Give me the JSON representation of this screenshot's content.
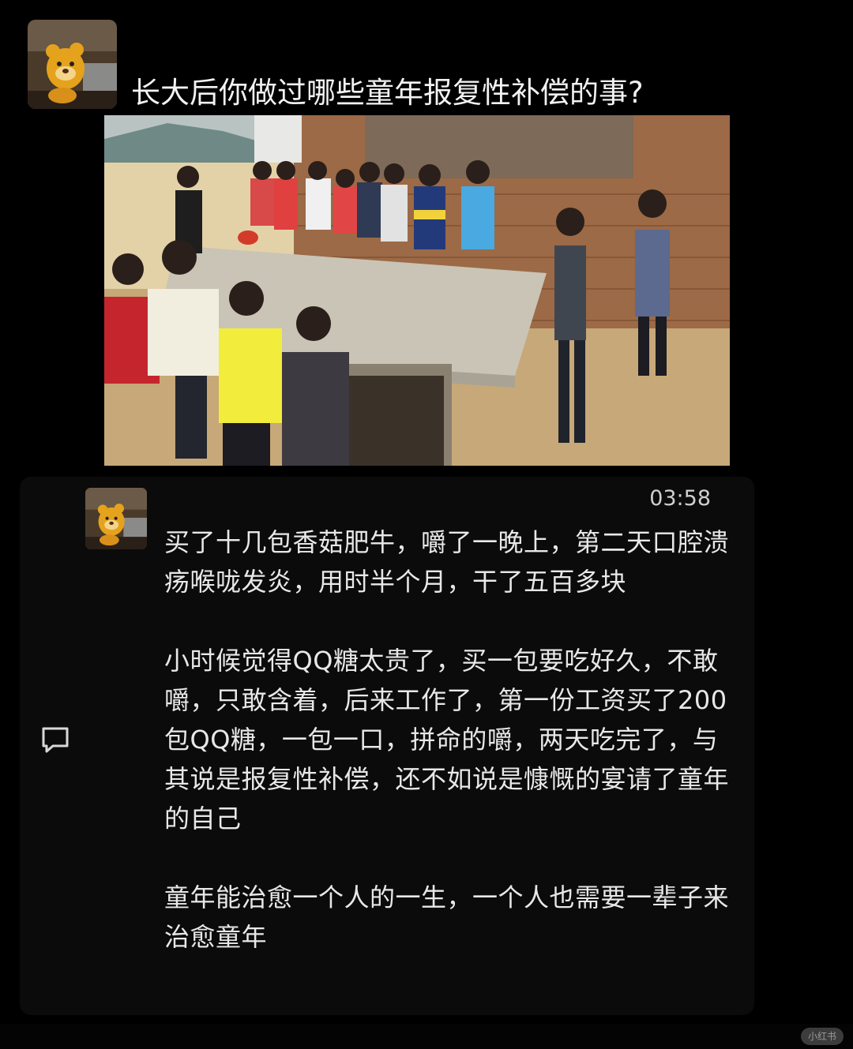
{
  "post": {
    "title": "长大后你做过哪些童年报复性补偿的事?"
  },
  "reply": {
    "timestamp": "03:58",
    "paragraphs": [
      "买了十几包香菇肥牛，嚼了一晚上，第二天口腔溃疡喉咙发炎，用时半个月，干了五百多块",
      "小时候觉得QQ糖太贵了，买一包要吃好久，不敢嚼，只敢含着，后来工作了，第一份工资买了200包QQ糖，一包一口，拼命的嚼，两天吃完了，与其说是报复性补偿，还不如说是慷慨的宴请了童年的自己",
      "童年能治愈一个人的一生，一个人也需要一辈子来治愈童年"
    ]
  },
  "icons": {
    "avatar": "cartoon-bear-avatar",
    "comment": "comment-bubble-icon"
  },
  "watermark": {
    "label": "小红书"
  },
  "colors": {
    "background": "#000000",
    "text": "#e8e8e8",
    "card": "#0b0b0b"
  }
}
